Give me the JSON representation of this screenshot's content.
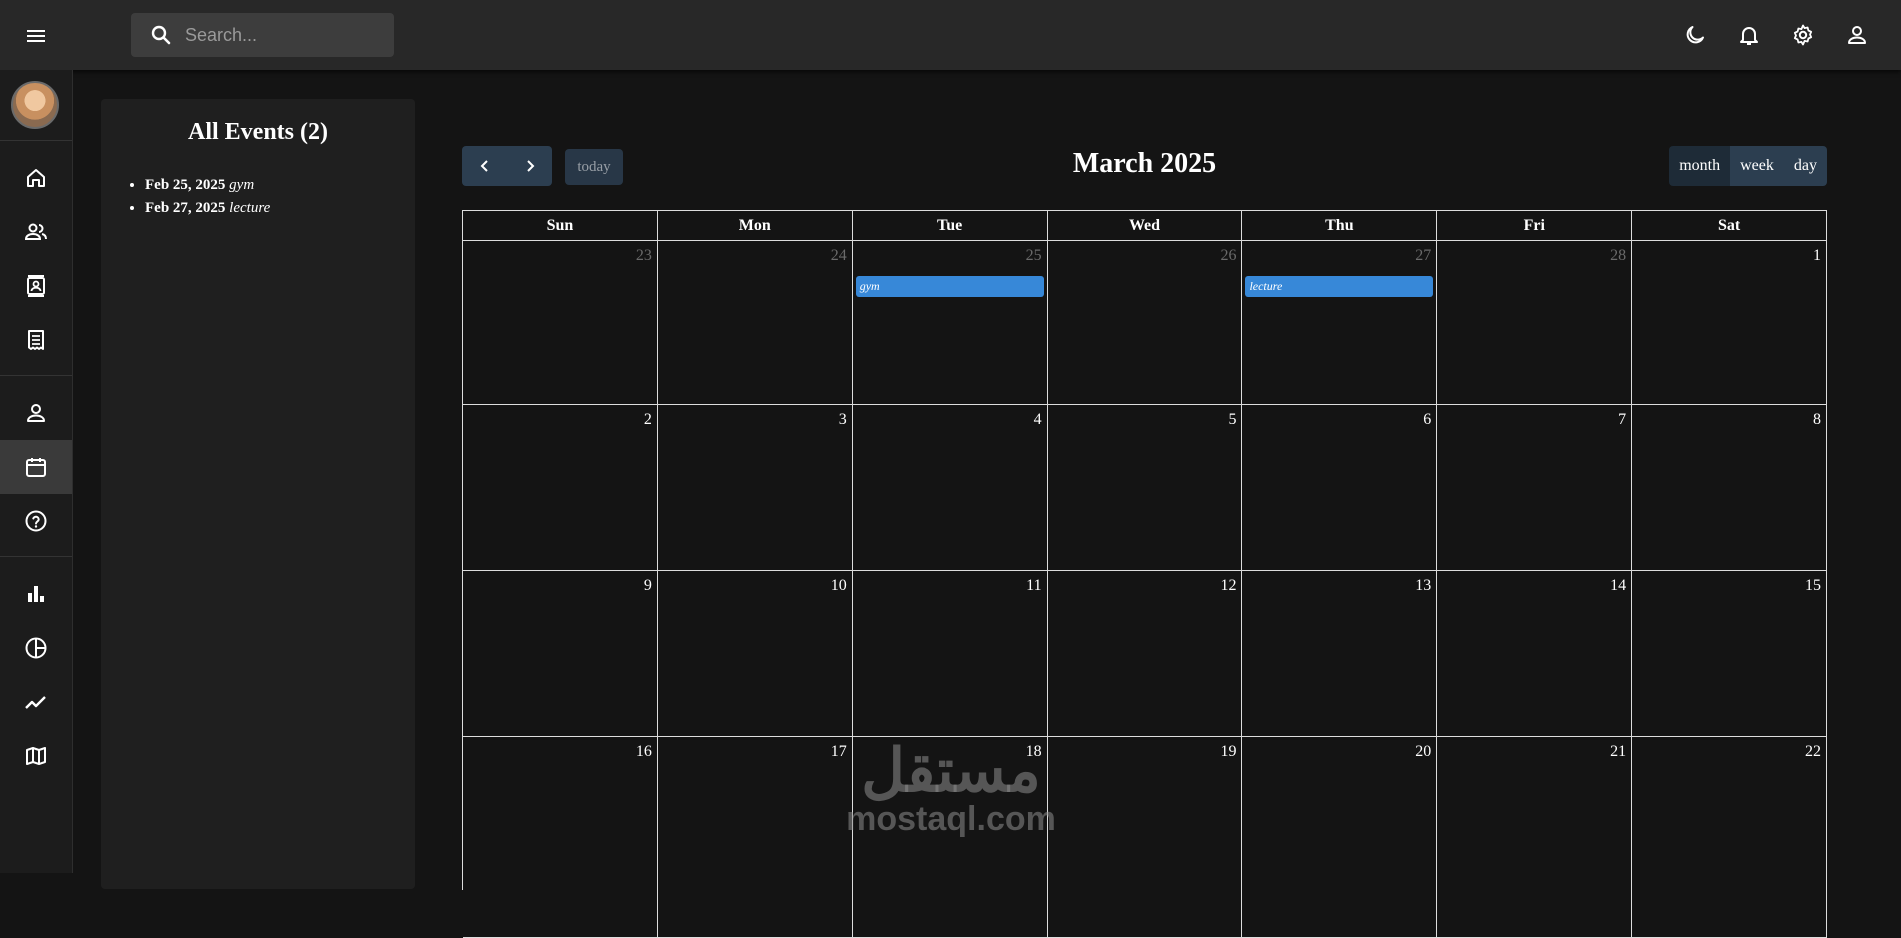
{
  "topbar": {
    "search_placeholder": "Search..."
  },
  "icons": {
    "menu": "hamburger-icon",
    "search": "search-icon",
    "top_right": [
      "moon-icon",
      "bell-icon",
      "gear-icon",
      "person-icon"
    ],
    "sidebar": [
      "home-icon",
      "people-icon",
      "contacts-icon",
      "receipt-icon",
      "person-icon",
      "calendar-icon",
      "help-icon",
      "bar-chart-icon",
      "pie-chart-icon",
      "line-chart-icon",
      "map-icon"
    ]
  },
  "events_panel": {
    "title": "All Events (2)",
    "events": [
      {
        "date": "Feb 25, 2025",
        "title": "gym"
      },
      {
        "date": "Feb 27, 2025",
        "title": "lecture"
      }
    ]
  },
  "calendar": {
    "title": "March 2025",
    "today_label": "today",
    "views": [
      "month",
      "week",
      "day"
    ],
    "active_view": "month",
    "weekdays": [
      "Sun",
      "Mon",
      "Tue",
      "Wed",
      "Thu",
      "Fri",
      "Sat"
    ],
    "weeks": [
      [
        {
          "d": "23",
          "o": true
        },
        {
          "d": "24",
          "o": true
        },
        {
          "d": "25",
          "o": true,
          "ev": "gym"
        },
        {
          "d": "26",
          "o": true
        },
        {
          "d": "27",
          "o": true,
          "ev": "lecture"
        },
        {
          "d": "28",
          "o": true
        },
        {
          "d": "1"
        }
      ],
      [
        {
          "d": "2"
        },
        {
          "d": "3"
        },
        {
          "d": "4"
        },
        {
          "d": "5"
        },
        {
          "d": "6"
        },
        {
          "d": "7"
        },
        {
          "d": "8"
        }
      ],
      [
        {
          "d": "9"
        },
        {
          "d": "10"
        },
        {
          "d": "11"
        },
        {
          "d": "12"
        },
        {
          "d": "13"
        },
        {
          "d": "14"
        },
        {
          "d": "15"
        }
      ],
      [
        {
          "d": "16"
        },
        {
          "d": "17"
        },
        {
          "d": "18"
        },
        {
          "d": "19"
        },
        {
          "d": "20"
        },
        {
          "d": "21"
        },
        {
          "d": "22"
        }
      ]
    ],
    "event_color": "#3788d8"
  },
  "watermark": {
    "arabic": "مستقل",
    "latin": "mostaql.com"
  }
}
